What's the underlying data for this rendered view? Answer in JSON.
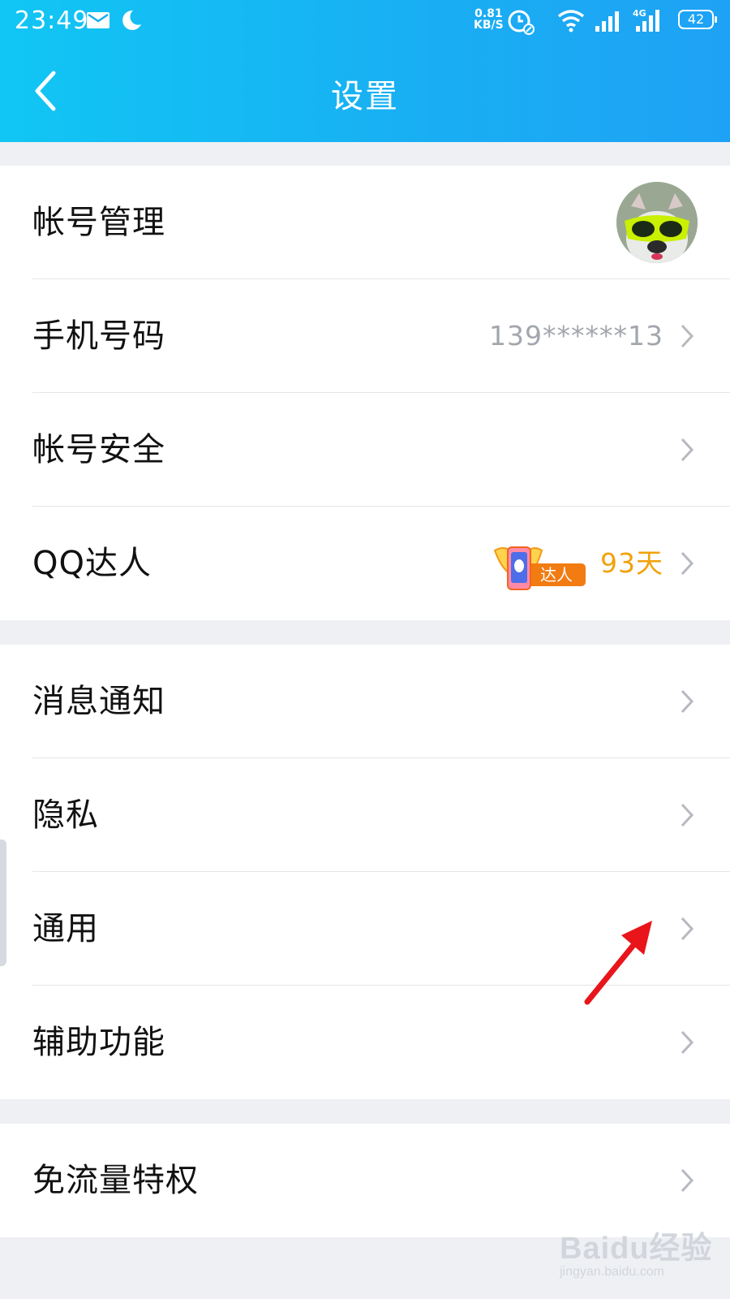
{
  "status_bar": {
    "time": "23:49",
    "net_speed_value": "0.81",
    "net_speed_unit": "KB/S",
    "battery": "42"
  },
  "header": {
    "title": "设置",
    "bg_color_start": "#11c6f4",
    "bg_color_end": "#1ea2f5"
  },
  "groups": [
    {
      "items": [
        {
          "label": "帐号管理",
          "trailing": "avatar"
        },
        {
          "label": "手机号码",
          "value": "139******13"
        },
        {
          "label": "帐号安全"
        },
        {
          "label": "QQ达人",
          "badge_text": "达人",
          "value": "93天"
        }
      ]
    },
    {
      "items": [
        {
          "label": "消息通知"
        },
        {
          "label": "隐私"
        },
        {
          "label": "通用"
        },
        {
          "label": "辅助功能"
        }
      ]
    },
    {
      "items": [
        {
          "label": "免流量特权"
        }
      ]
    }
  ],
  "watermark": {
    "brand": "Baidu经验",
    "url": "jingyan.baidu.com"
  },
  "colors": {
    "value_gray": "#a2a6ad",
    "days_orange": "#f1a20a",
    "arrow_red": "#e8151b"
  }
}
